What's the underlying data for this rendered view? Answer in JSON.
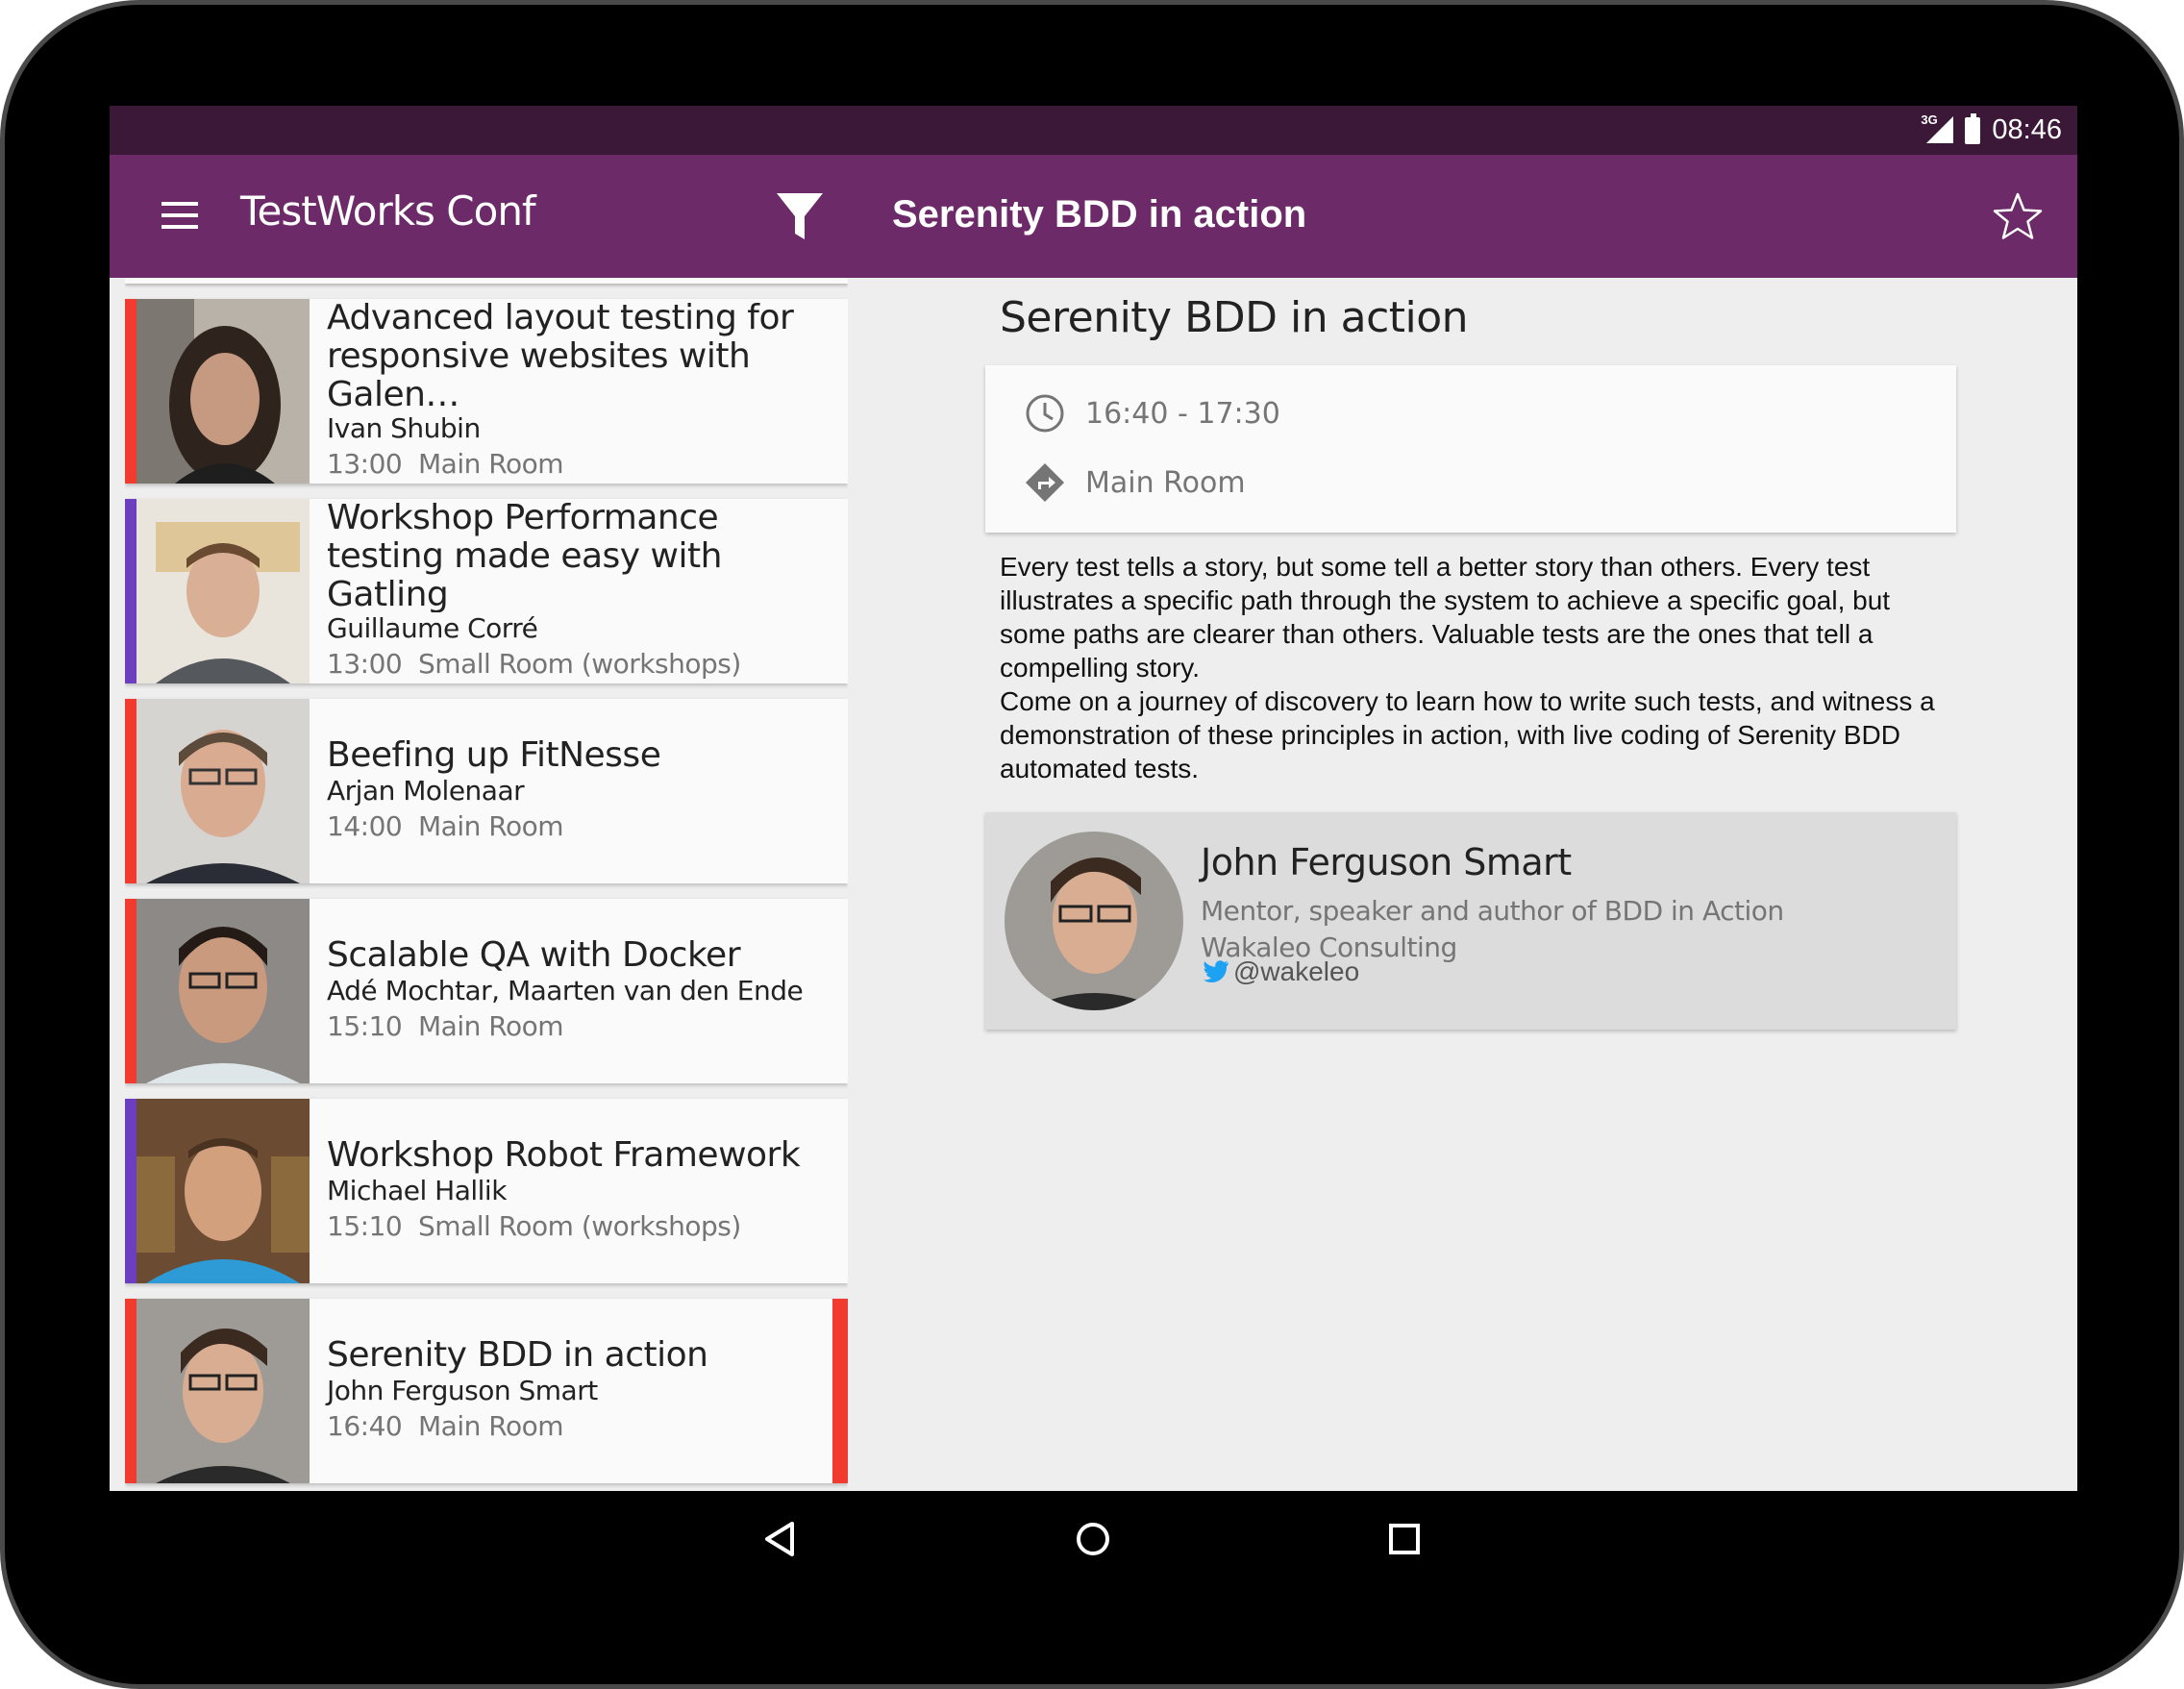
{
  "status_bar": {
    "network": "3G",
    "time": "08:46"
  },
  "app_bar": {
    "app_title": "TestWorks Conf",
    "detail_title": "Serenity BDD in action"
  },
  "sessions": [
    {
      "title": "Advanced layout testing for responsive websites with Galen…",
      "speaker": "Ivan Shubin",
      "time": "13:00",
      "room": "Main Room",
      "track_color": "#f23b2f"
    },
    {
      "title": "Workshop Performance testing made easy with Gatling",
      "speaker": "Guillaume Corré",
      "time": "13:00",
      "room": "Small Room (workshops)",
      "track_color": "#6b3fbf"
    },
    {
      "title": "Beefing up FitNesse",
      "speaker": "Arjan Molenaar",
      "time": "14:00",
      "room": "Main Room",
      "track_color": "#f23b2f"
    },
    {
      "title": "Scalable QA with Docker",
      "speaker": "Adé Mochtar, Maarten van den Ende",
      "time": "15:10",
      "room": "Main Room",
      "track_color": "#f23b2f"
    },
    {
      "title": "Workshop Robot Framework",
      "speaker": "Michael Hallik",
      "time": "15:10",
      "room": "Small Room (workshops)",
      "track_color": "#6b3fbf"
    },
    {
      "title": "Serenity BDD in action",
      "speaker": "John Ferguson Smart",
      "time": "16:40",
      "room": "Main Room",
      "track_color": "#f23b2f",
      "selected": true
    }
  ],
  "detail": {
    "title": "Serenity BDD in action",
    "time_range": "16:40 - 17:30",
    "room": "Main Room",
    "description": [
      "Every test tells a story, but some tell a better story than others. Every test illustrates a specific path through the system to achieve a specific goal, but some paths are clearer than others. Valuable tests are the ones that tell a compelling story.",
      "Come on a journey of discovery to learn how to write such tests, and witness a demonstration of these principles in action, with live coding of Serenity BDD automated tests."
    ],
    "speaker": {
      "name": "John Ferguson Smart",
      "bio": "Mentor, speaker and author of BDD in Action",
      "company": "Wakaleo Consulting",
      "twitter": "@wakeleo"
    }
  },
  "colors": {
    "status_bar": "#3c1838",
    "app_bar": "#6d2a69",
    "accent_red": "#f23b2f",
    "accent_purple": "#6b3fbf",
    "twitter": "#1da1f2"
  },
  "icons": [
    "menu-icon",
    "filter-icon",
    "star-icon",
    "clock-icon",
    "directions-icon",
    "twitter-icon",
    "back-icon",
    "home-icon",
    "recents-icon"
  ]
}
